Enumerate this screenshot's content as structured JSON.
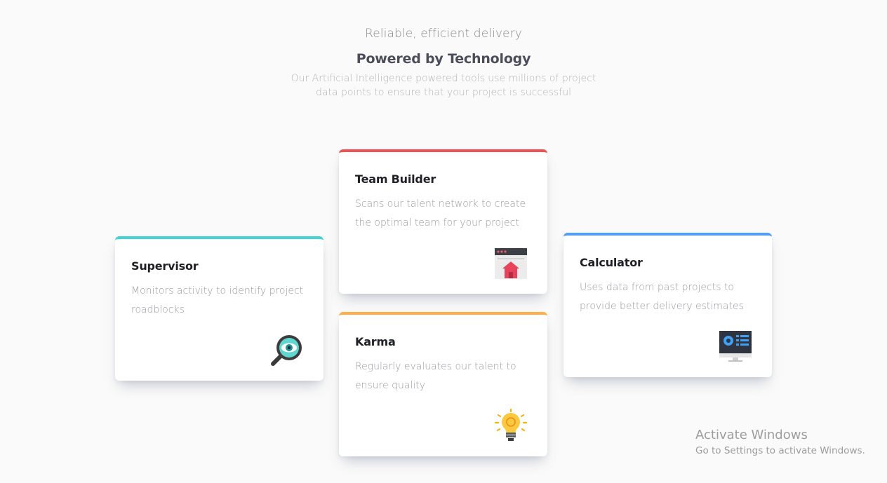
{
  "header": {
    "subtitle": "Reliable, efficient delivery",
    "title": "Powered by Technology",
    "description": "Our Artificial Intelligence powered tools use millions of project data points to ensure that your project is successful"
  },
  "cards": [
    {
      "title": "Supervisor",
      "description": "Monitors activity to identify project roadblocks",
      "accent": "#44d3d2",
      "icon": "magnifier-eye-icon"
    },
    {
      "title": "Team Builder",
      "description": "Scans our talent network to create the optimal team for your project",
      "accent": "#ea5454",
      "icon": "browser-home-icon"
    },
    {
      "title": "Karma",
      "description": "Regularly evaluates our talent to ensure quality",
      "accent": "#fcaf4a",
      "icon": "lightbulb-icon"
    },
    {
      "title": "Calculator",
      "description": "Uses data from past projects to provide better delivery estimates",
      "accent": "#549ef2",
      "icon": "monitor-dashboard-icon"
    }
  ],
  "watermark": {
    "line1": "Activate Windows",
    "line2": "Go to Settings to activate Windows."
  }
}
